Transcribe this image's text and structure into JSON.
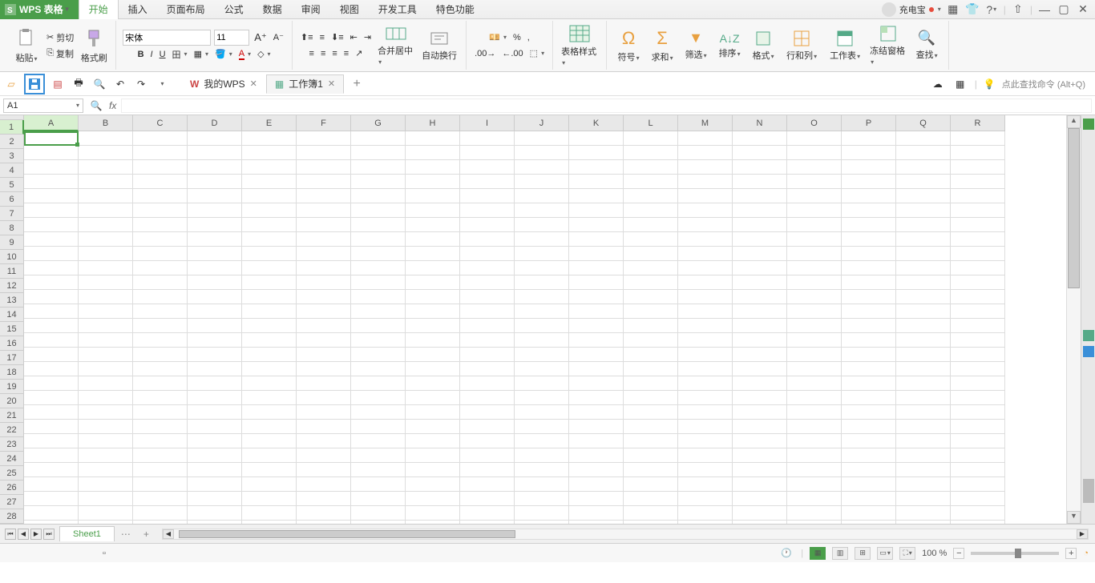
{
  "app": {
    "name": "WPS 表格"
  },
  "menuTabs": [
    "开始",
    "插入",
    "页面布局",
    "公式",
    "数据",
    "审阅",
    "视图",
    "开发工具",
    "特色功能"
  ],
  "activeMenuTab": 0,
  "user": {
    "name": "充电宝"
  },
  "ribbon": {
    "paste": "粘贴",
    "cut": "剪切",
    "copy": "复制",
    "formatPainter": "格式刷",
    "font": "宋体",
    "fontSize": "11",
    "mergeCenter": "合并居中",
    "autoWrap": "自动换行",
    "tableStyle": "表格样式",
    "symbol": "符号",
    "sum": "求和",
    "filter": "筛选",
    "sort": "排序",
    "format": "格式",
    "rowsCols": "行和列",
    "worksheet": "工作表",
    "freezePanes": "冻结窗格",
    "find": "查找"
  },
  "docTabs": [
    {
      "label": "我的WPS",
      "icon": "wps"
    },
    {
      "label": "工作簿1",
      "icon": "sheet",
      "active": true
    }
  ],
  "searchHint": "点此查找命令 (Alt+Q)",
  "nameBox": "A1",
  "columns": [
    "A",
    "B",
    "C",
    "D",
    "E",
    "F",
    "G",
    "H",
    "I",
    "J",
    "K",
    "L",
    "M",
    "N",
    "O",
    "P",
    "Q",
    "R"
  ],
  "visibleRows": 28,
  "selectedCell": {
    "row": 1,
    "col": "A"
  },
  "sheetTabs": [
    "Sheet1"
  ],
  "zoom": "100 %"
}
